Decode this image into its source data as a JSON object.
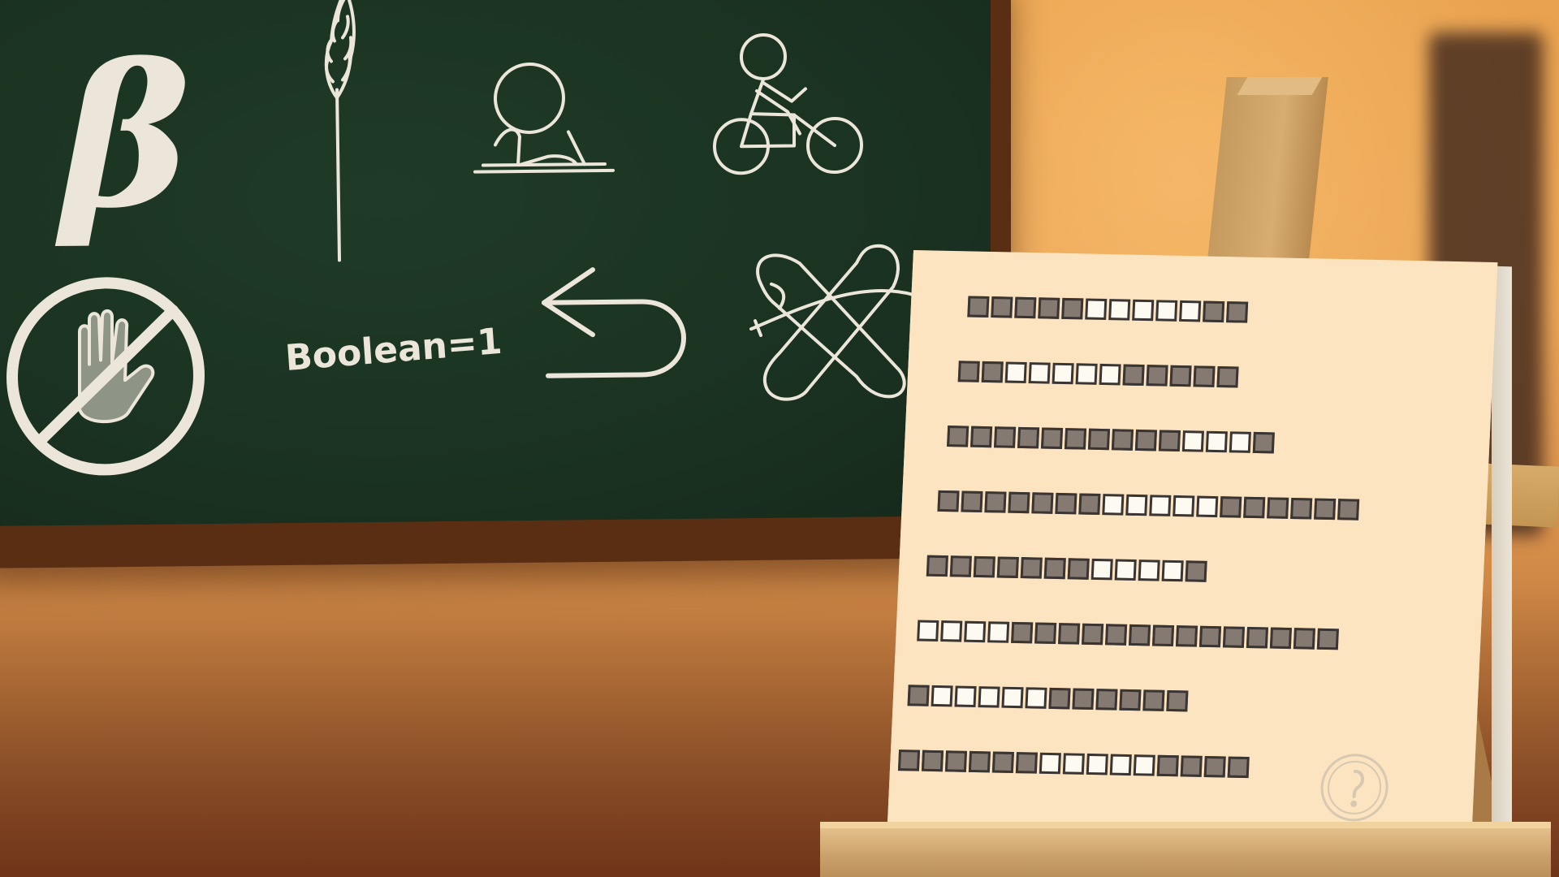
{
  "scene": {
    "chalkboard": {
      "symbols": [
        "beta-symbol",
        "wheat-icon",
        "studying-person-icon",
        "cyclist-icon",
        "no-hand-icon",
        "back-arrow-icon",
        "knot-icon"
      ],
      "beta": "β",
      "boolean_text": "Boolean=1"
    },
    "sign": {
      "rows": [
        "■■■■■□□□□□■■",
        "■■□□□□□■■■■■",
        "■■■■■■■■■■□□□■",
        "■■■■■■■□□□□□■■■■■■",
        "■■■■■■■□□□□■",
        "□□□□■■■■■■■■■■■■■■",
        "■□□□□□■■■■■■",
        "■■■■■■□□□□□■■■■"
      ],
      "seal": "seal-icon"
    },
    "colors": {
      "chalkboard": "#1b3322",
      "frame": "#5a2e12",
      "chalk": "#ece6da",
      "paper": "#fde4c0",
      "filled_box": "#857a72",
      "empty_box": "#fdfaf2",
      "wall": "#e9a24f"
    }
  }
}
